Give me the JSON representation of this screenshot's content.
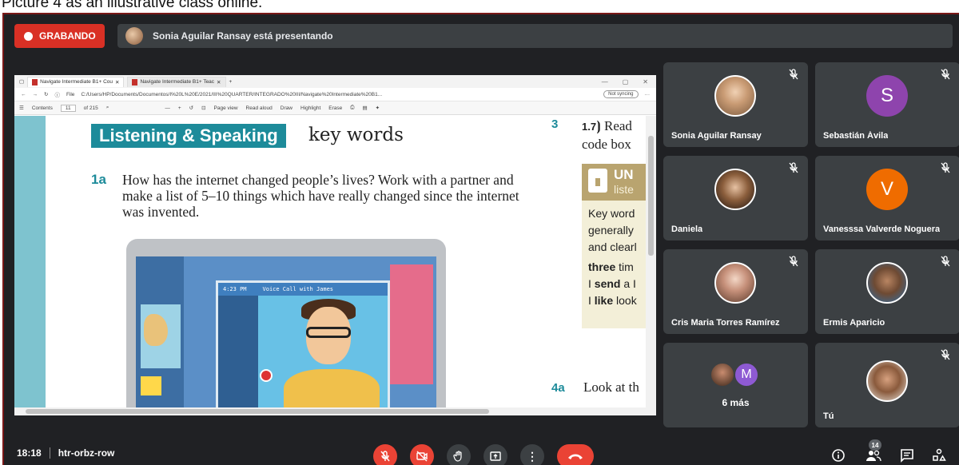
{
  "caption": "Picture 4 as an illustrative class online.",
  "topbar": {
    "recording_label": "GRABANDO",
    "presenting_text": "Sonia Aguilar Ransay está presentando"
  },
  "browser": {
    "tabs": [
      {
        "label": "Navigate Intermediate B1+ Cou"
      },
      {
        "label": "Navigate Intermediate B1+ Teac"
      }
    ],
    "address": "C:/Users/HP/Documents/Documentos/I%20L%20E/2021/III%20QUARTER/INTEGRADO%20III/Navigate%20Intermediate%20B1...",
    "file_label": "File",
    "sync_label": "Not syncing",
    "toolbar": {
      "contents": "Contents",
      "page_num": "11",
      "page_total": "of 215",
      "page_view": "Page view",
      "read_aloud": "Read aloud",
      "draw": "Draw",
      "highlight": "Highlight",
      "erase": "Erase"
    }
  },
  "pdf": {
    "badge": "Listening & Speaking",
    "badge_suffix": "key words",
    "q1a_num": "1a",
    "q1a_text": "How has the internet changed people’s lives? Work with a partner and make a list of 5–10 things which have really changed since the internet was invented.",
    "call_time": "4:23 PM",
    "call_title": "Voice Call with James",
    "q3_num": "3",
    "q3_track": "1.7",
    "q3_line1": "Read",
    "q3_line2": "code box",
    "unlock_t1": "UN",
    "unlock_t2": "liste",
    "key_lines": [
      "Key word",
      "generally",
      "and clearl"
    ],
    "key_bold1": "three",
    "key_after1": " tim",
    "key_pre2": "I ",
    "key_bold2": "send",
    "key_after2": " a I",
    "key_pre3": "I ",
    "key_bold3": "like",
    "key_after3": " look",
    "q4a_num": "4a",
    "q4a_text": "Look at th"
  },
  "participants": [
    {
      "name": "Sonia Aguilar Ransay",
      "muted": true,
      "avatar": "photo"
    },
    {
      "name": "Sebastián Ávila",
      "muted": true,
      "avatar": "letter",
      "letter": "S",
      "color": "#8e44ad"
    },
    {
      "name": "Daniela",
      "muted": true,
      "avatar": "photo"
    },
    {
      "name": "Vanesssa Valverde Noguera",
      "muted": true,
      "avatar": "letter",
      "letter": "V",
      "color": "#ef6c00"
    },
    {
      "name": "Cris Maria Torres Ramírez",
      "muted": true,
      "avatar": "photo"
    },
    {
      "name": "Ermis Aparicio",
      "muted": true,
      "avatar": "photo"
    },
    {
      "name": "6 más",
      "muted": false,
      "avatar": "group",
      "letter": "M"
    },
    {
      "name": "Tú",
      "muted": true,
      "avatar": "photo"
    }
  ],
  "bottombar": {
    "time": "18:18",
    "meeting_code": "htr-orbz-row",
    "people_count": "14"
  },
  "colors": {
    "recording_red": "#d93025",
    "control_red": "#ea4335",
    "tile_bg": "#3c4043",
    "meet_bg": "#202124"
  }
}
